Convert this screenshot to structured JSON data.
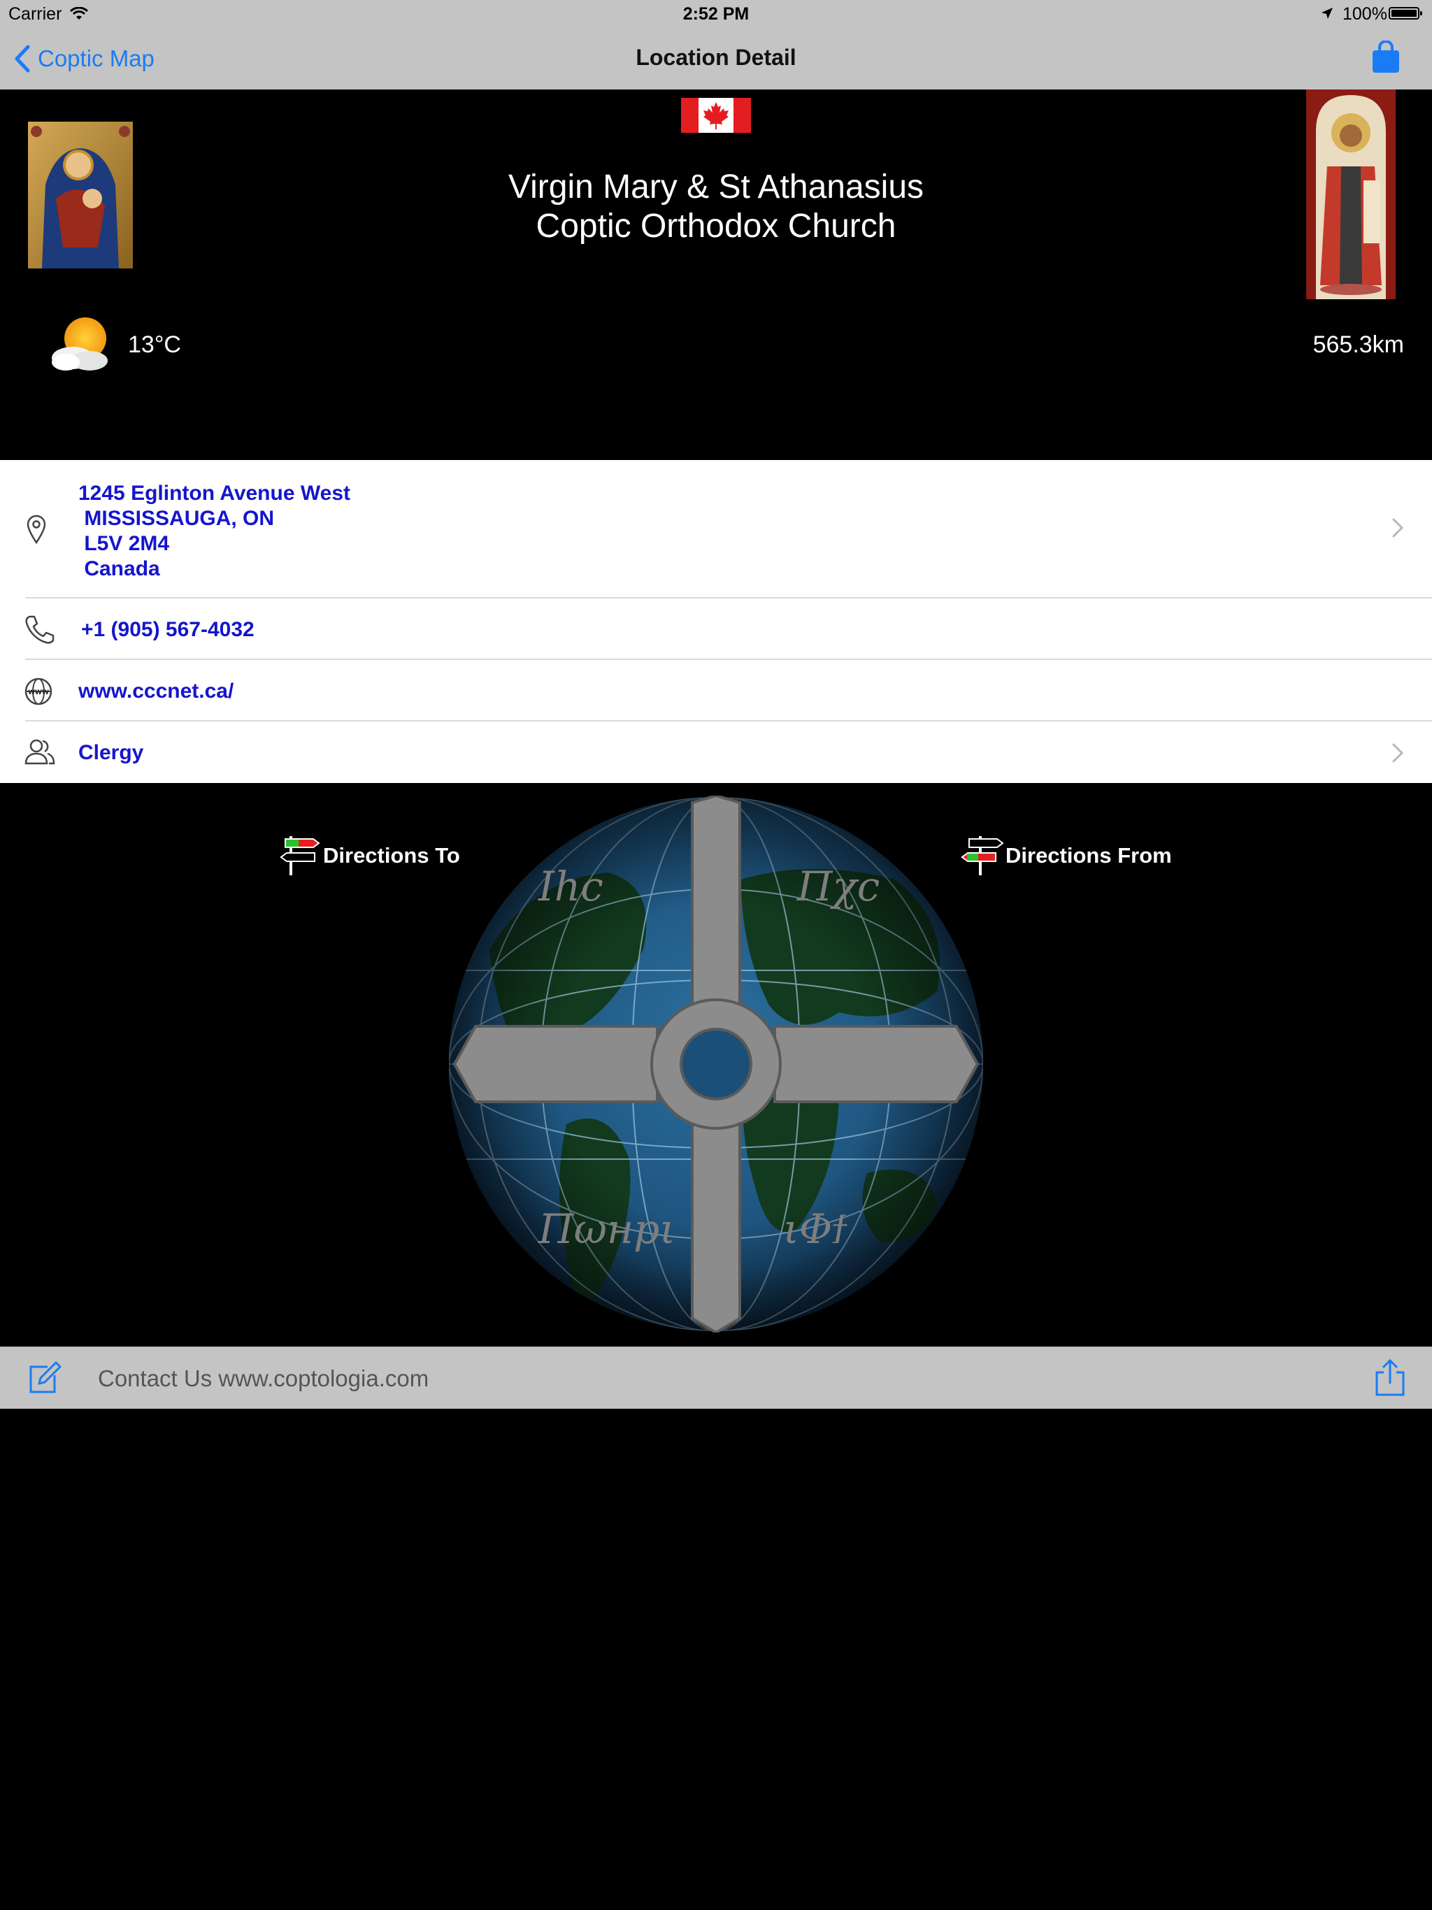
{
  "status_bar": {
    "carrier": "Carrier",
    "time": "2:52 PM",
    "battery_pct": "100%",
    "battery_level": 1.0
  },
  "nav": {
    "back_label": "Coptic Map",
    "title": "Location Detail",
    "accent_color": "#1a7cf5"
  },
  "header": {
    "flag": "canada-flag",
    "left_icon": "virgin-mary-icon",
    "right_icon": "st-athanasius-icon",
    "church_name_line1": "Virgin Mary & St Athanasius",
    "church_name_line2": "Coptic Orthodox Church",
    "weather_icon": "partly-cloudy-icon",
    "temperature": "13°C",
    "distance": "565.3km"
  },
  "details": {
    "address": "1245 Eglinton Avenue West\n MISSISSAUGA, ON\n L5V 2M4\n Canada",
    "phone": "+1 (905) 567-4032",
    "website": "www.cccnet.ca/",
    "clergy": "Clergy",
    "link_color": "#1515cc"
  },
  "directions": {
    "to_label": "Directions To",
    "from_label": "Directions From"
  },
  "globe": {
    "inscription_top_left": "Ihc",
    "inscription_top_right": "Πχc",
    "inscription_bottom_left": "Πωнрι",
    "inscription_bottom_right": "ιΦϯ"
  },
  "toolbar": {
    "contact_text": "Contact Us www.coptologia.com"
  }
}
